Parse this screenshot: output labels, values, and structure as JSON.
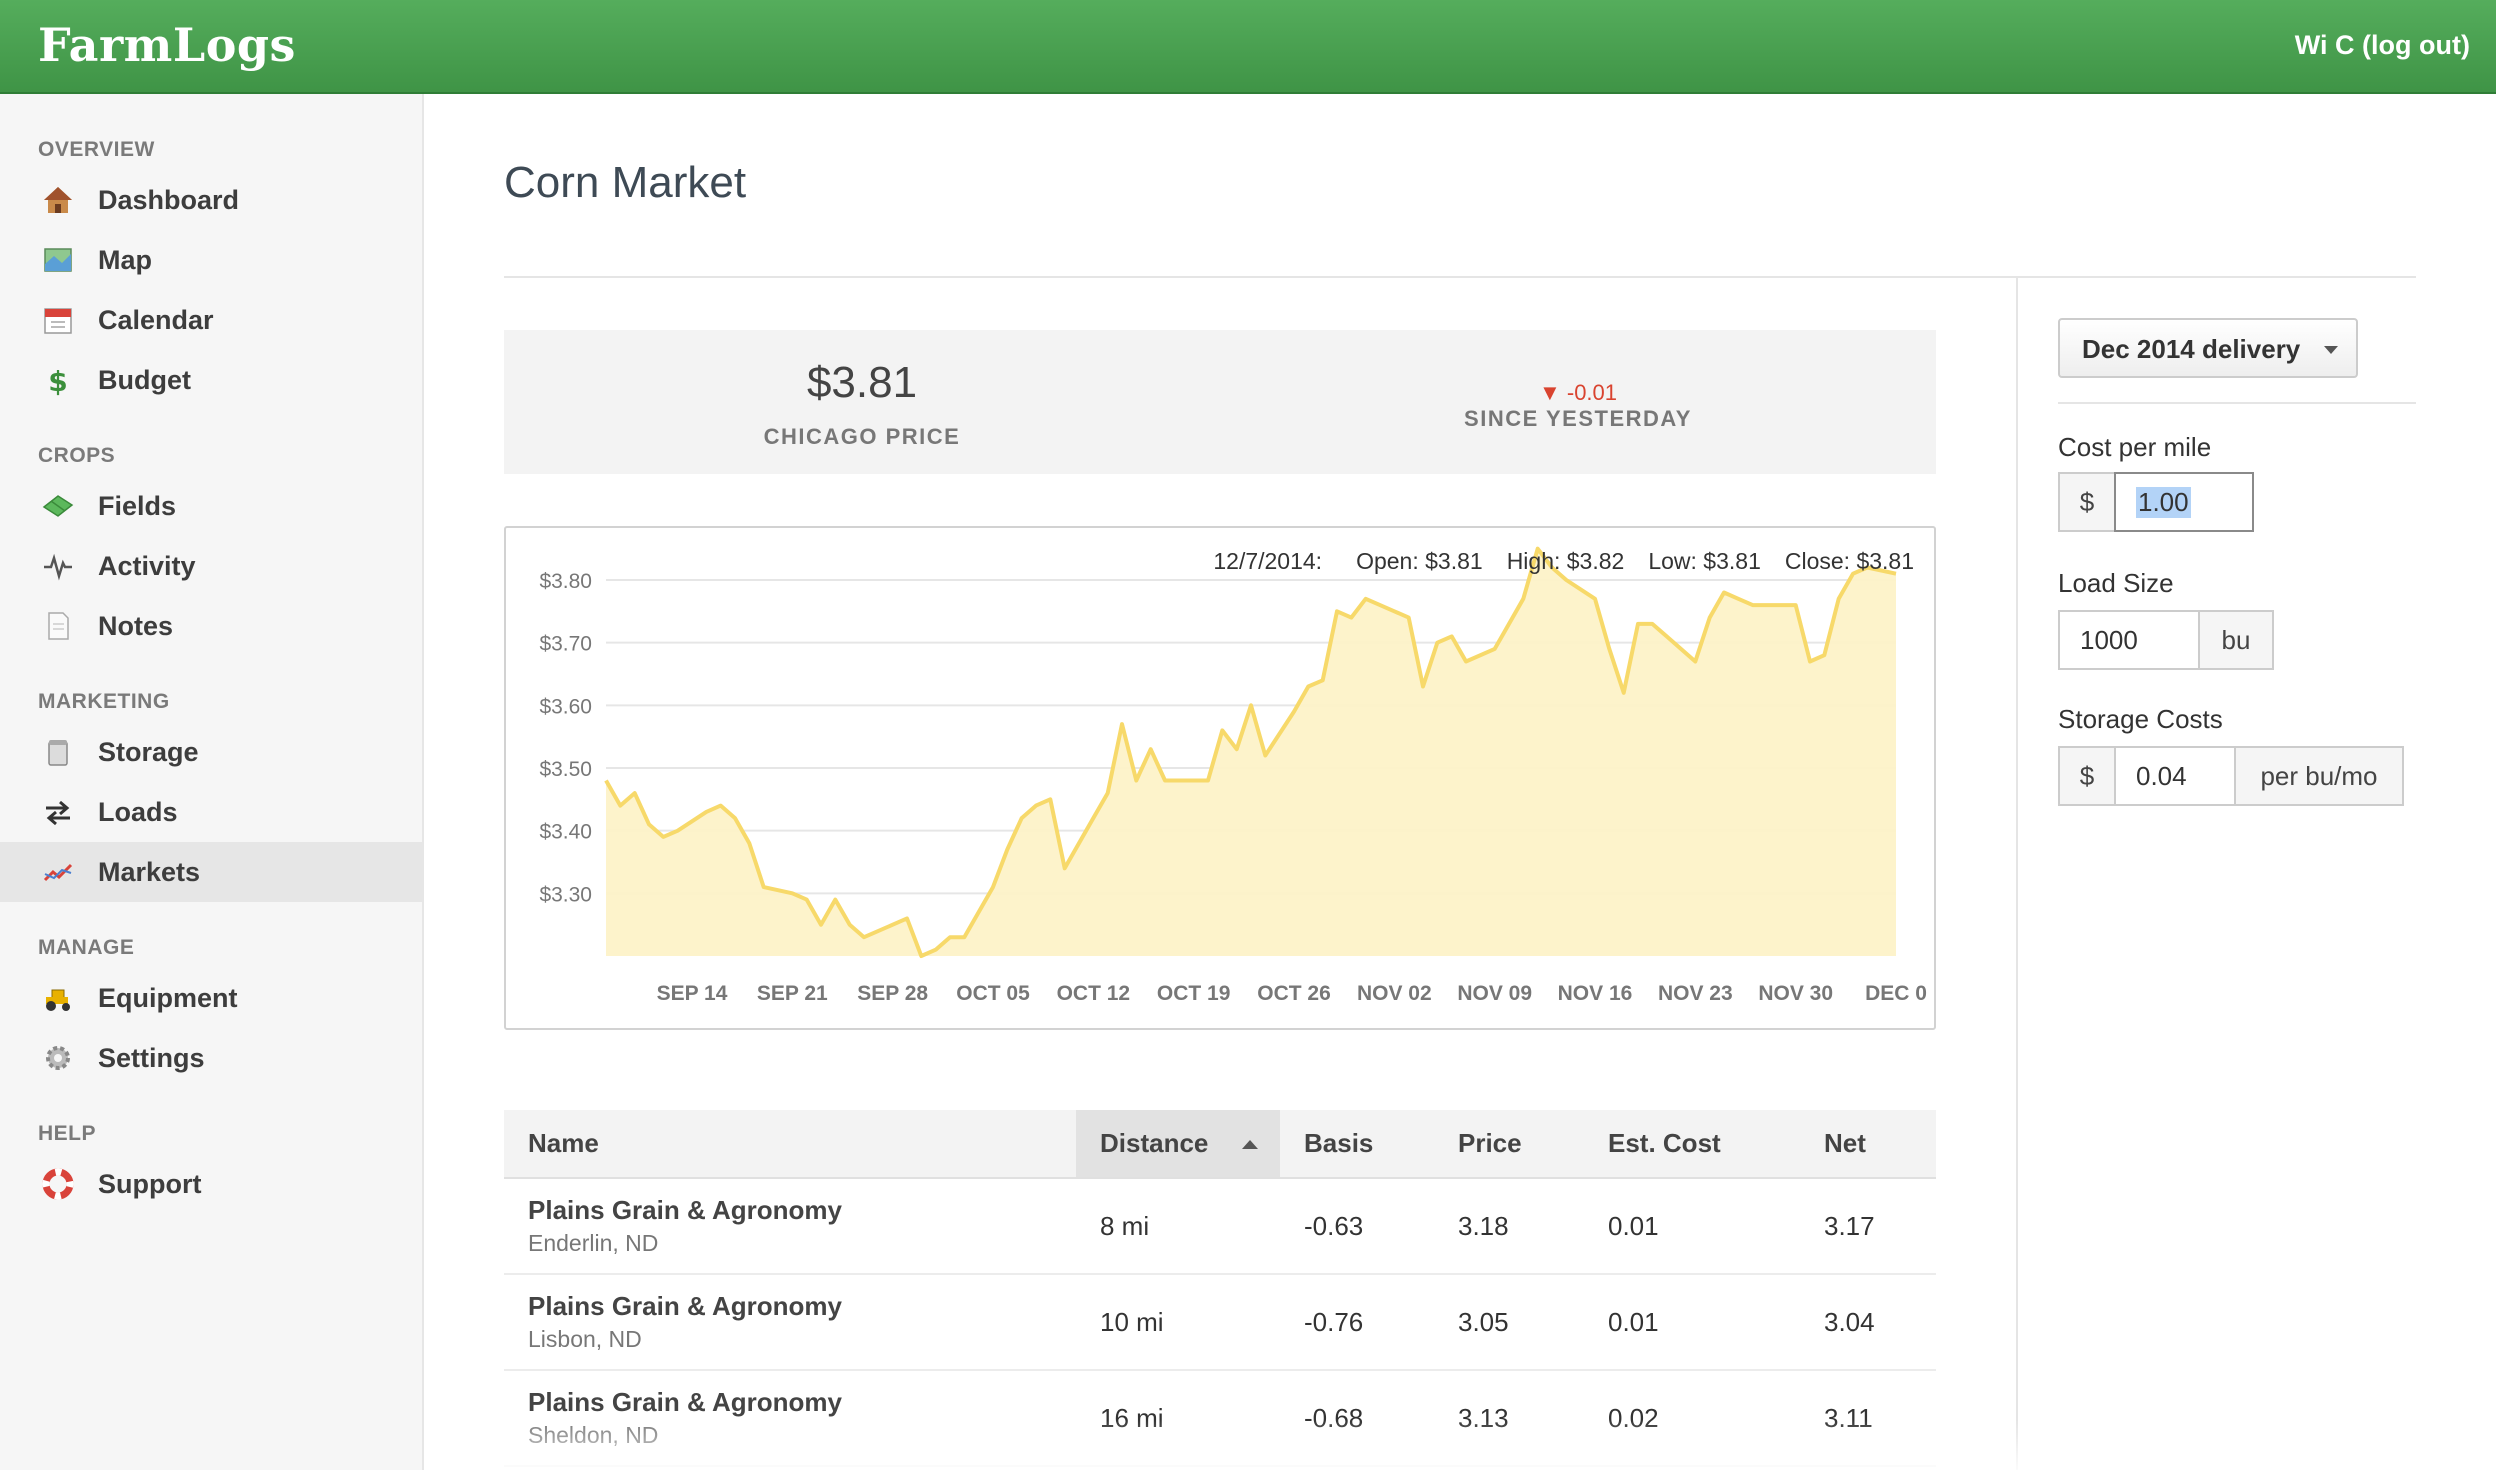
{
  "header": {
    "brand": "FarmLogs",
    "user_link": "Wi C (log out)"
  },
  "sidebar": {
    "sections": [
      {
        "title": "OVERVIEW",
        "items": [
          {
            "label": "Dashboard",
            "icon": "house-icon"
          },
          {
            "label": "Map",
            "icon": "map-icon"
          },
          {
            "label": "Calendar",
            "icon": "calendar-icon"
          },
          {
            "label": "Budget",
            "icon": "dollar-icon"
          }
        ]
      },
      {
        "title": "CROPS",
        "items": [
          {
            "label": "Fields",
            "icon": "field-icon"
          },
          {
            "label": "Activity",
            "icon": "pulse-icon"
          },
          {
            "label": "Notes",
            "icon": "note-icon"
          }
        ]
      },
      {
        "title": "MARKETING",
        "items": [
          {
            "label": "Storage",
            "icon": "storage-icon"
          },
          {
            "label": "Loads",
            "icon": "arrows-icon"
          },
          {
            "label": "Markets",
            "icon": "chart-line-icon",
            "active": true
          }
        ]
      },
      {
        "title": "MANAGE",
        "items": [
          {
            "label": "Equipment",
            "icon": "tractor-icon"
          },
          {
            "label": "Settings",
            "icon": "gear-icon"
          }
        ]
      },
      {
        "title": "HELP",
        "items": [
          {
            "label": "Support",
            "icon": "lifebuoy-icon"
          }
        ]
      }
    ]
  },
  "main": {
    "title": "Corn Market",
    "price": {
      "value": "$3.81",
      "label": "CHICAGO PRICE"
    },
    "change": {
      "value": "▼ -0.01",
      "label": "SINCE YESTERDAY"
    },
    "tooltip": {
      "date": "12/7/2014:",
      "open": "Open: $3.81",
      "high": "High: $3.82",
      "low": "Low: $3.81",
      "close": "Close: $3.81"
    }
  },
  "chart_data": {
    "type": "area",
    "title": "",
    "xlabel": "",
    "ylabel": "",
    "x_tick_labels": [
      "SEP 14",
      "SEP 21",
      "SEP 28",
      "OCT 05",
      "OCT 12",
      "OCT 19",
      "OCT 26",
      "NOV 02",
      "NOV 09",
      "NOV 16",
      "NOV 23",
      "NOV 30",
      "DEC 0"
    ],
    "y_tick_labels": [
      "$3.80",
      "$3.70",
      "$3.60",
      "$3.50",
      "$3.40",
      "$3.30"
    ],
    "ylim": [
      3.2,
      3.8
    ],
    "grid": true,
    "x_start": "2014-09-08",
    "series": [
      {
        "name": "",
        "x": [
          "2014-09-08",
          "2014-09-09",
          "2014-09-10",
          "2014-09-11",
          "2014-09-12",
          "2014-09-13",
          "2014-09-15",
          "2014-09-16",
          "2014-09-17",
          "2014-09-18",
          "2014-09-19",
          "2014-09-21",
          "2014-09-22",
          "2014-09-23",
          "2014-09-24",
          "2014-09-25",
          "2014-09-26",
          "2014-09-28",
          "2014-09-29",
          "2014-09-30",
          "2014-10-01",
          "2014-10-02",
          "2014-10-03",
          "2014-10-05",
          "2014-10-06",
          "2014-10-07",
          "2014-10-08",
          "2014-10-09",
          "2014-10-10",
          "2014-10-12",
          "2014-10-13",
          "2014-10-14",
          "2014-10-15",
          "2014-10-16",
          "2014-10-17",
          "2014-10-19",
          "2014-10-20",
          "2014-10-21",
          "2014-10-22",
          "2014-10-23",
          "2014-10-24",
          "2014-10-26",
          "2014-10-27",
          "2014-10-28",
          "2014-10-29",
          "2014-10-30",
          "2014-10-31",
          "2014-11-02",
          "2014-11-03",
          "2014-11-04",
          "2014-11-05",
          "2014-11-06",
          "2014-11-07",
          "2014-11-09",
          "2014-11-10",
          "2014-11-11",
          "2014-11-12",
          "2014-11-13",
          "2014-11-14",
          "2014-11-16",
          "2014-11-17",
          "2014-11-18",
          "2014-11-19",
          "2014-11-20",
          "2014-11-21",
          "2014-11-23",
          "2014-11-24",
          "2014-11-25",
          "2014-11-26",
          "2014-11-27",
          "2014-11-28",
          "2014-11-30",
          "2014-12-01",
          "2014-12-02",
          "2014-12-03",
          "2014-12-04",
          "2014-12-05",
          "2014-12-07"
        ],
        "values": [
          3.48,
          3.44,
          3.46,
          3.41,
          3.39,
          3.4,
          3.43,
          3.44,
          3.42,
          3.38,
          3.31,
          3.3,
          3.29,
          3.25,
          3.29,
          3.25,
          3.23,
          3.25,
          3.26,
          3.2,
          3.21,
          3.23,
          3.23,
          3.31,
          3.37,
          3.42,
          3.44,
          3.45,
          3.34,
          3.42,
          3.46,
          3.57,
          3.48,
          3.53,
          3.48,
          3.48,
          3.48,
          3.56,
          3.53,
          3.6,
          3.52,
          3.59,
          3.63,
          3.64,
          3.75,
          3.74,
          3.77,
          3.75,
          3.74,
          3.63,
          3.7,
          3.71,
          3.67,
          3.69,
          3.73,
          3.77,
          3.85,
          3.82,
          3.8,
          3.77,
          3.69,
          3.62,
          3.73,
          3.73,
          3.71,
          3.67,
          3.74,
          3.78,
          3.77,
          3.76,
          3.76,
          3.76,
          3.67,
          3.68,
          3.77,
          3.81,
          3.82,
          3.81
        ]
      }
    ]
  },
  "table": {
    "columns": [
      "Name",
      "Distance",
      "Basis",
      "Price",
      "Est. Cost",
      "Net"
    ],
    "sorted_column": "Distance",
    "rows": [
      {
        "name": "Plains Grain & Agronomy",
        "location": "Enderlin, ND",
        "distance": "8 mi",
        "basis": "-0.63",
        "price": "3.18",
        "cost": "0.01",
        "net": "3.17"
      },
      {
        "name": "Plains Grain & Agronomy",
        "location": "Lisbon, ND",
        "distance": "10 mi",
        "basis": "-0.76",
        "price": "3.05",
        "cost": "0.01",
        "net": "3.04"
      },
      {
        "name": "Plains Grain & Agronomy",
        "location": "Sheldon, ND",
        "distance": "16 mi",
        "basis": "-0.68",
        "price": "3.13",
        "cost": "0.02",
        "net": "3.11"
      }
    ]
  },
  "right_panel": {
    "delivery_select": "Dec 2014 delivery",
    "cost_per_mile": {
      "label": "Cost per mile",
      "prefix": "$",
      "value": "1.00"
    },
    "load_size": {
      "label": "Load Size",
      "value": "1000",
      "suffix": "bu"
    },
    "storage_costs": {
      "label": "Storage Costs",
      "prefix": "$",
      "value": "0.04",
      "suffix": "per bu/mo"
    }
  },
  "colors": {
    "header_green": "#4ca553",
    "chart_line": "#f7d96a",
    "chart_fill": "#fdf2c8",
    "negative": "#d9432f"
  }
}
